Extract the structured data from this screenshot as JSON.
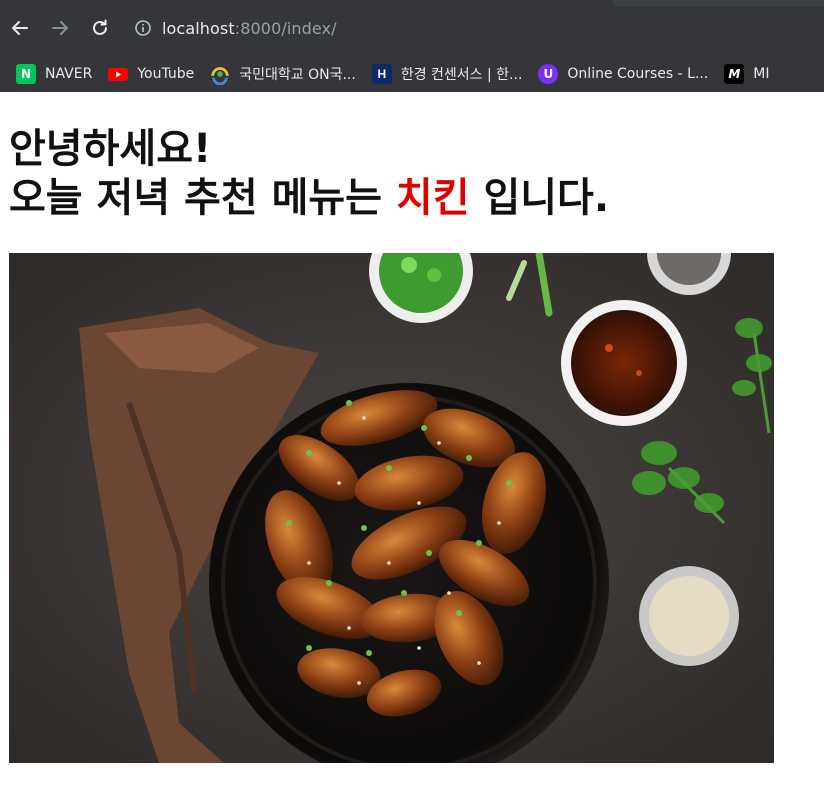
{
  "browser": {
    "url_host": "localhost",
    "url_rest": ":8000/index/",
    "bookmarks": [
      {
        "label": "NAVER",
        "icon": "naver-icon",
        "glyph": "N"
      },
      {
        "label": "YouTube",
        "icon": "youtube-icon"
      },
      {
        "label": "국민대학교 ON국...",
        "icon": "kookmin-icon"
      },
      {
        "label": "한경 컨센서스 | 한...",
        "icon": "hankyung-icon",
        "glyph": "H"
      },
      {
        "label": "Online Courses - L...",
        "icon": "online-courses-icon",
        "glyph": "U"
      },
      {
        "label": "MI",
        "icon": "m-icon",
        "glyph": "M"
      }
    ]
  },
  "page": {
    "greeting": "안녕하세요!",
    "recommend_prefix": "오늘 저녁 추천 메뉴는 ",
    "menu_item": "치킨",
    "recommend_suffix": " 입니다.",
    "accent_color": "#e00000"
  }
}
